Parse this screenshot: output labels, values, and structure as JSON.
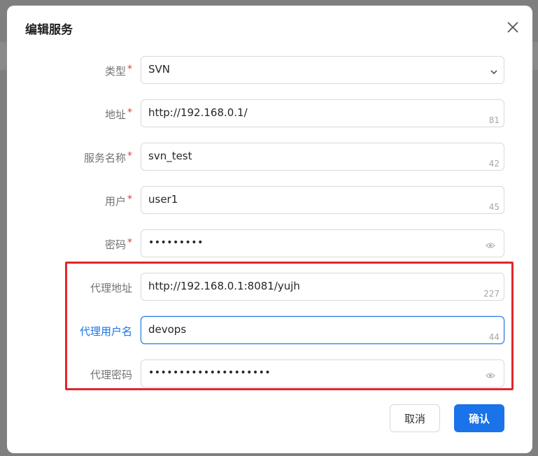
{
  "dialog": {
    "title": "编辑服务",
    "close_icon": "close-icon"
  },
  "form": {
    "required_mark": "*",
    "type": {
      "label": "类型",
      "value": "SVN"
    },
    "address": {
      "label": "地址",
      "value": "http://192.168.0.1/",
      "count": "81"
    },
    "service_name": {
      "label": "服务名称",
      "value": "svn_test",
      "count": "42"
    },
    "user": {
      "label": "用户",
      "value": "user1",
      "count": "45"
    },
    "password": {
      "label": "密码",
      "value": "•••••••••"
    },
    "proxy_address": {
      "label": "代理地址",
      "value": "http://192.168.0.1:8081/yujh",
      "count": "227"
    },
    "proxy_user": {
      "label": "代理用户名",
      "value": "devops",
      "count": "44"
    },
    "proxy_password": {
      "label": "代理密码",
      "value": "••••••••••••••••••••"
    }
  },
  "buttons": {
    "cancel": "取消",
    "confirm": "确认"
  },
  "colors": {
    "accent": "#1a73e8",
    "required": "#e53935",
    "highlight": "#e0262b"
  }
}
